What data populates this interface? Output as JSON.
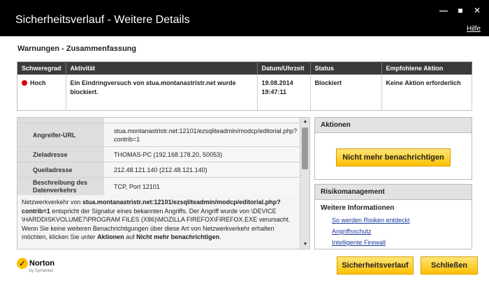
{
  "window": {
    "title": "Sicherheitsverlauf - Weitere Details",
    "help": "Hilfe",
    "minimize_glyph": "—",
    "maximize_glyph": "■",
    "close_glyph": "✕"
  },
  "warnings": {
    "title": "Warnungen - Zusammenfassung",
    "columns": [
      "Schweregrad",
      "Aktivität",
      "Datum/Uhrzeit",
      "Status",
      "Empfohlene Aktion"
    ],
    "row": {
      "severity": "Hoch",
      "severity_color": "#d40000",
      "activity": "Ein Eindringversuch von stua.montanastristr.net wurde blockiert.",
      "date": "19.08.2014",
      "time": "19:47:11",
      "status": "Blockiert",
      "action": "Keine Aktion erforderlich"
    }
  },
  "details": {
    "rows": [
      {
        "label": "Angreifer-URL",
        "value": "stua.montanastristr.net:12101/ezsqliteadmin/modcp/editorial.php?contrib=1"
      },
      {
        "label": "Zieladresse",
        "value": "THOMAS-PC (192.168.178.20, 50053)"
      },
      {
        "label": "Quelladresse",
        "value": "212.48.121.140 (212.48.121.140)"
      },
      {
        "label": "Beschreibung des Datenverkehrs",
        "value": "TCP, Port 12101"
      }
    ],
    "description": {
      "p1": "Netzwerkverkehr von ",
      "b1": "stua.montanastristr.net:12101/ezsqliteadmin/modcp/editorial.php?contrib=1",
      "p2": " entspricht der Signatur eines bekannten Angriffs. Der Angriff wurde von \\DEVICE \\HARDDISKVOLUME7\\PROGRAM FILES (X86)\\MOZILLA FIREFOX\\FIREFOX.EXE verursacht. Wenn Sie keine weiteren Benachrichtigungen über diese Art von Netzwerkverkehr erhalten möchten, klicken Sie unter ",
      "b2": "Aktionen",
      "p3": " auf ",
      "b3": "Nicht mehr benachrichtigen",
      "p4": "."
    },
    "scroll_up": "▲",
    "scroll_down": "▼"
  },
  "actions": {
    "title": "Aktionen",
    "button": "Nicht mehr benachrichtigen"
  },
  "risk": {
    "title": "Risikomanagement",
    "subtitle": "Weitere Informationen",
    "links": [
      "So werden Risiken entdeckt",
      "Angriffsschutz",
      "Intelligente Firewall"
    ]
  },
  "footer": {
    "logo_name": "Norton",
    "logo_by": "by Symantec",
    "history_button": "Sicherheitsverlauf",
    "close_button": "Schließen"
  },
  "colors": {
    "accent_yellow": "#ffc000",
    "titlebar": "#000000",
    "link": "#1a3a9a"
  }
}
